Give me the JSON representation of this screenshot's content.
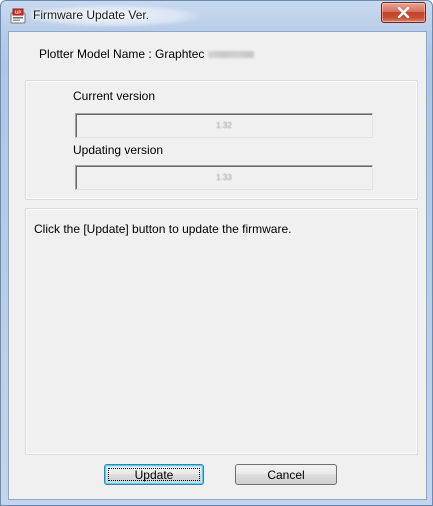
{
  "window": {
    "title": "Firmware Update Ver."
  },
  "model": {
    "label": "Plotter Model Name : Graphtec"
  },
  "versions": {
    "current_label": "Current version",
    "current_value": "1.32",
    "updating_label": "Updating version",
    "updating_value": "1.33"
  },
  "message": {
    "text": "Click the [Update] button to update the firmware."
  },
  "buttons": {
    "update_label": "Update",
    "cancel_label": "Cancel"
  },
  "icons": {
    "app": "firmware-update-app-icon",
    "close": "close-icon"
  },
  "colors": {
    "title_bar": "#b8cde8",
    "close_button": "#c9533b",
    "dialog_background": "#f0f0f0",
    "default_button_border": "#3c7fb1"
  }
}
